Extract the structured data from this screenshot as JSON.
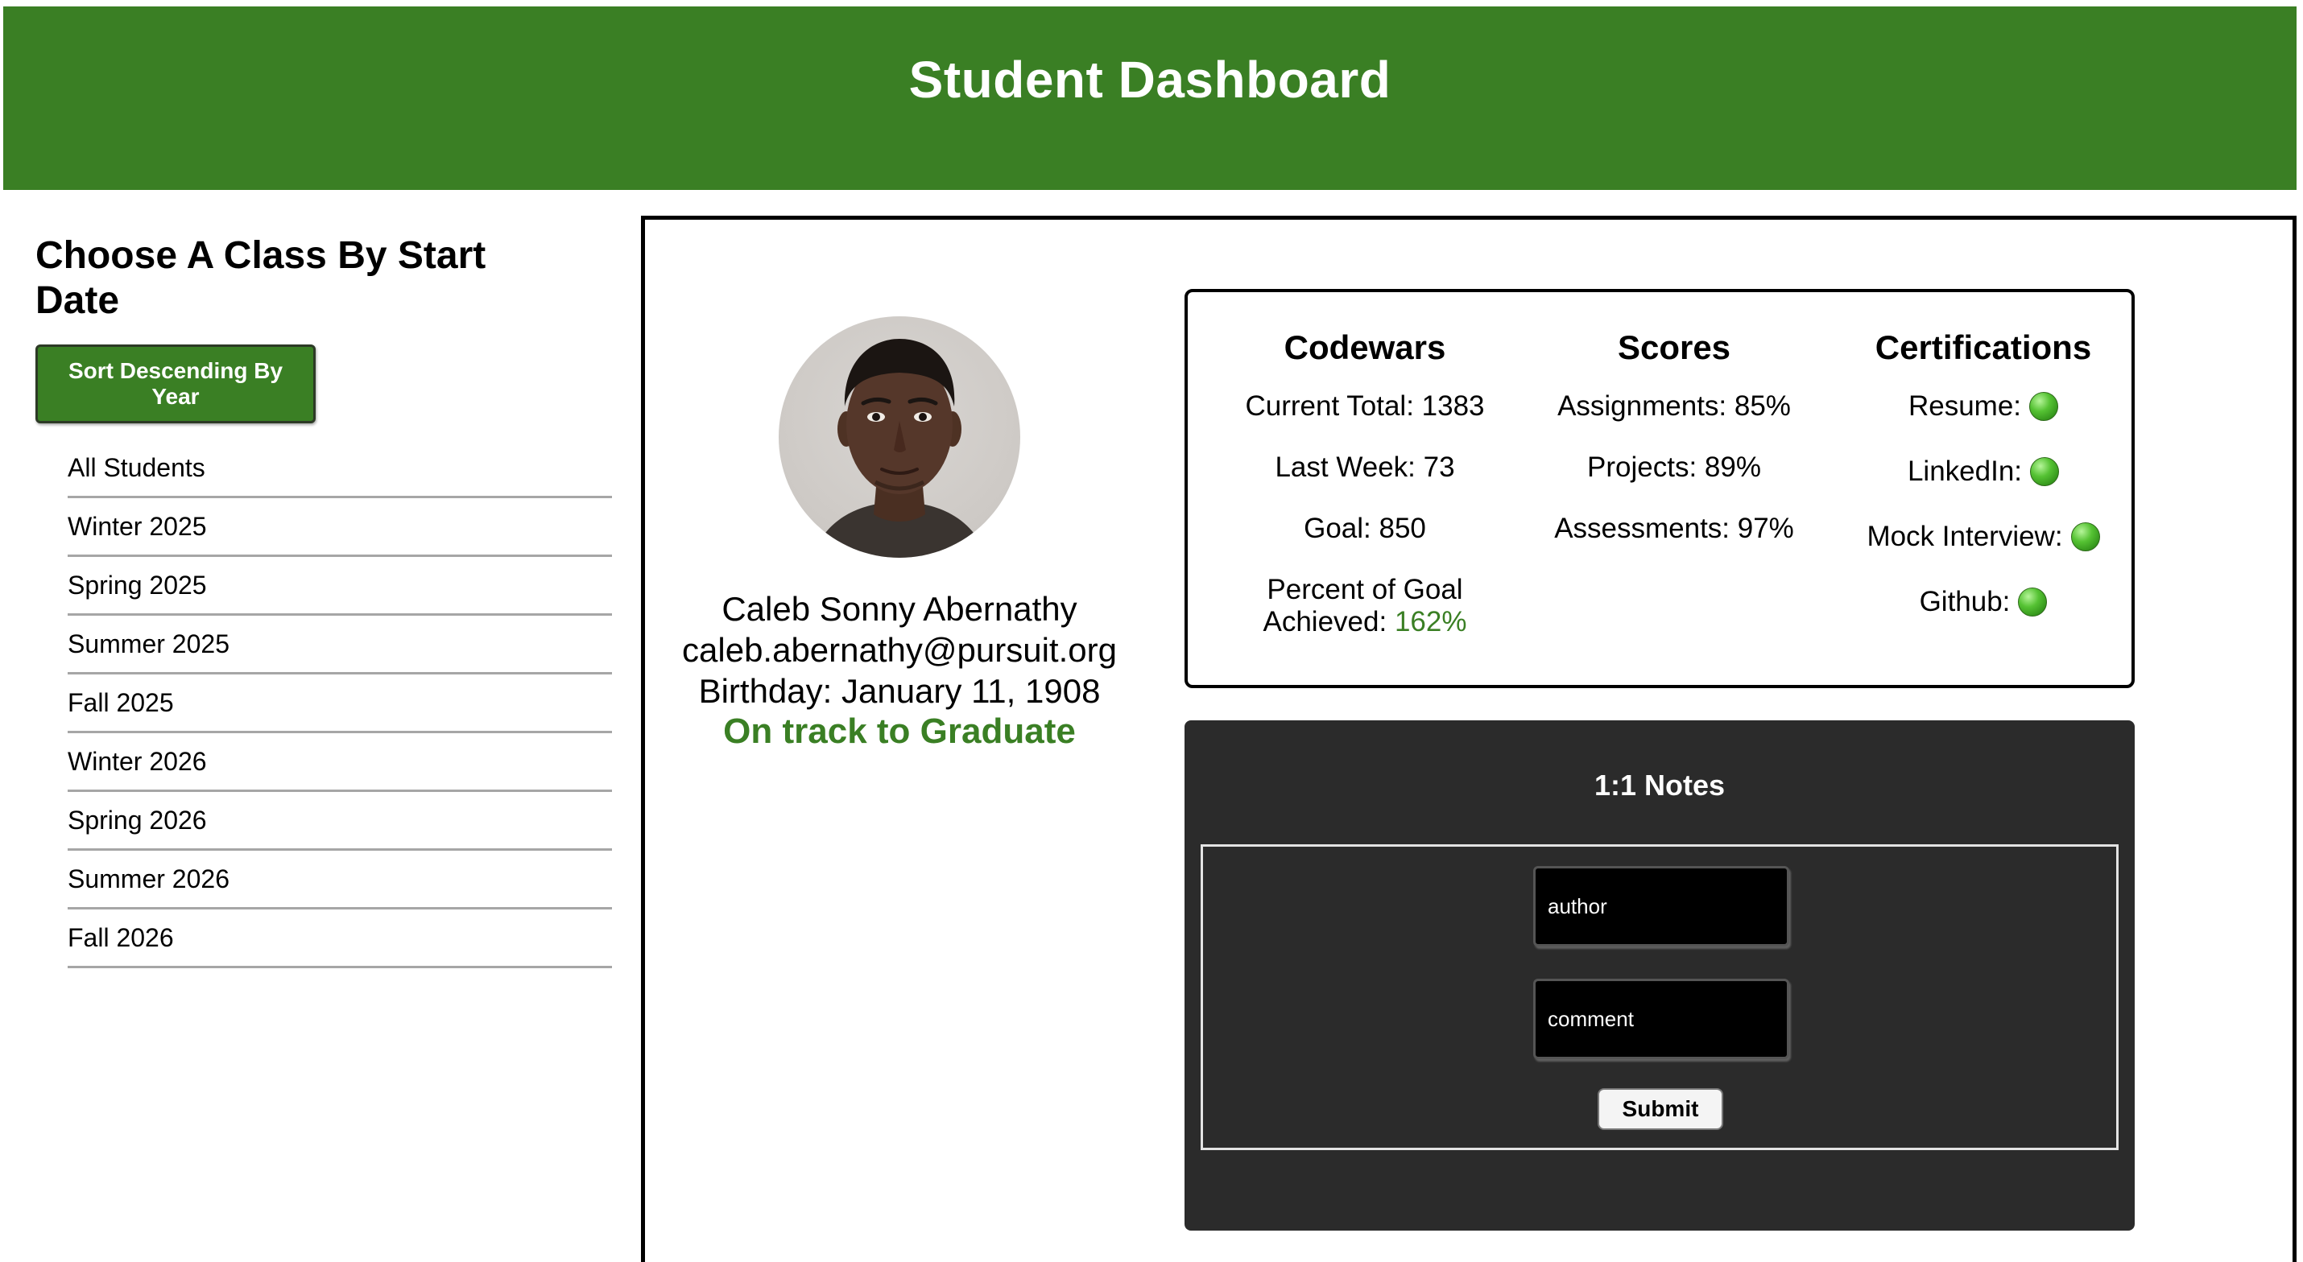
{
  "header": {
    "title": "Student Dashboard"
  },
  "sidebar": {
    "heading": "Choose A Class By Start Date",
    "sort_button": "Sort Descending By Year",
    "classes": [
      "All Students",
      "Winter 2025",
      "Spring 2025",
      "Summer 2025",
      "Fall 2025",
      "Winter 2026",
      "Spring 2026",
      "Summer 2026",
      "Fall 2026"
    ]
  },
  "student": {
    "name": "Caleb Sonny Abernathy",
    "email": "caleb.abernathy@pursuit.org",
    "birthday": "Birthday: January 11, 1908",
    "status": "On track to Graduate",
    "status_color": "#3a7f24"
  },
  "codewars": {
    "heading": "Codewars",
    "current_total": "Current Total: 1383",
    "last_week": "Last Week: 73",
    "goal": "Goal: 850",
    "percent_label": "Percent of Goal Achieved:",
    "percent_value": "162%"
  },
  "scores": {
    "heading": "Scores",
    "assignments": "Assignments: 85%",
    "projects": "Projects: 89%",
    "assessments": "Assessments: 97%"
  },
  "certifications": {
    "heading": "Certifications",
    "items": [
      {
        "label": "Resume:",
        "status": "green-dot-icon"
      },
      {
        "label": "LinkedIn:",
        "status": "green-dot-icon"
      },
      {
        "label": "Mock Interview:",
        "status": "green-dot-icon"
      },
      {
        "label": "Github:",
        "status": "green-dot-icon"
      }
    ]
  },
  "notes": {
    "heading": "1:1 Notes",
    "author_placeholder": "author",
    "comment_placeholder": "comment",
    "submit_label": "Submit"
  },
  "colors": {
    "accent_green": "#3a7f24",
    "notes_background": "#2b2b2b"
  }
}
